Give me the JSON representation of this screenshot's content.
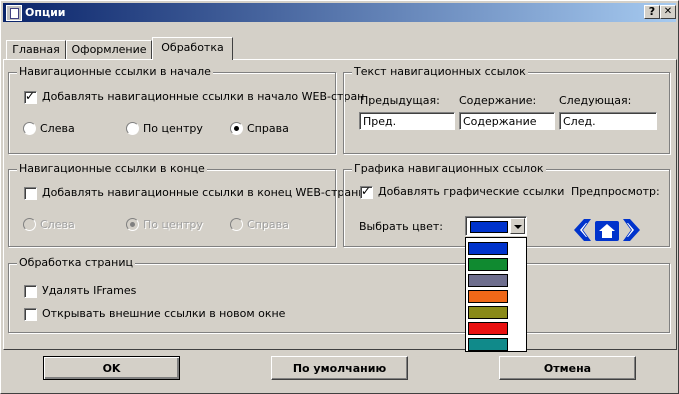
{
  "window": {
    "title": "Опции",
    "help_btn": "?",
    "close_btn": "✕"
  },
  "tabs": [
    {
      "label": "Главная"
    },
    {
      "label": "Оформление"
    },
    {
      "label": "Обработка"
    }
  ],
  "start_links": {
    "title": "Навигационные ссылки в начале",
    "checkbox_label": "Добавлять навигационные ссылки в начало WEB-стран",
    "checked": true,
    "radios": {
      "left": "Слева",
      "center": "По центру",
      "right": "Справа"
    },
    "selected": "right"
  },
  "end_links": {
    "title": "Навигационные ссылки в конце",
    "checkbox_label": "Добавлять навигационные ссылки в конец WEB-страни",
    "checked": false,
    "radios": {
      "left": "Слева",
      "center": "По центру",
      "right": "Справа"
    },
    "selected": "center"
  },
  "link_text": {
    "title": "Текст навигационных ссылок",
    "prev_label": "Предыдущая:",
    "contents_label": "Содержание:",
    "next_label": "Следующая:",
    "prev_value": "Пред.",
    "contents_value": "Содержание",
    "next_value": "След."
  },
  "link_graphics": {
    "title": "Графика навигационных ссылок",
    "checkbox_label": "Добавлять графические ссылки",
    "checked": true,
    "preview_label": "Предпросмотр:",
    "color_label": "Выбрать цвет:",
    "selected_color": "#0033cc",
    "color_options": [
      "#0033cc",
      "#108a30",
      "#6e6e8e",
      "#f06818",
      "#8a8a18",
      "#e81010",
      "#108a8a"
    ],
    "icons": [
      "arrow-left-icon",
      "home-icon",
      "arrow-right-icon"
    ]
  },
  "page_processing": {
    "title": "Обработка страниц",
    "remove_iframes": "Удалять IFrames",
    "remove_iframes_checked": false,
    "open_external": "Открывать внешние ссылки в новом окне",
    "open_external_checked": false
  },
  "buttons": {
    "ok": "OK",
    "default": "По умолчанию",
    "cancel": "Отмена"
  }
}
